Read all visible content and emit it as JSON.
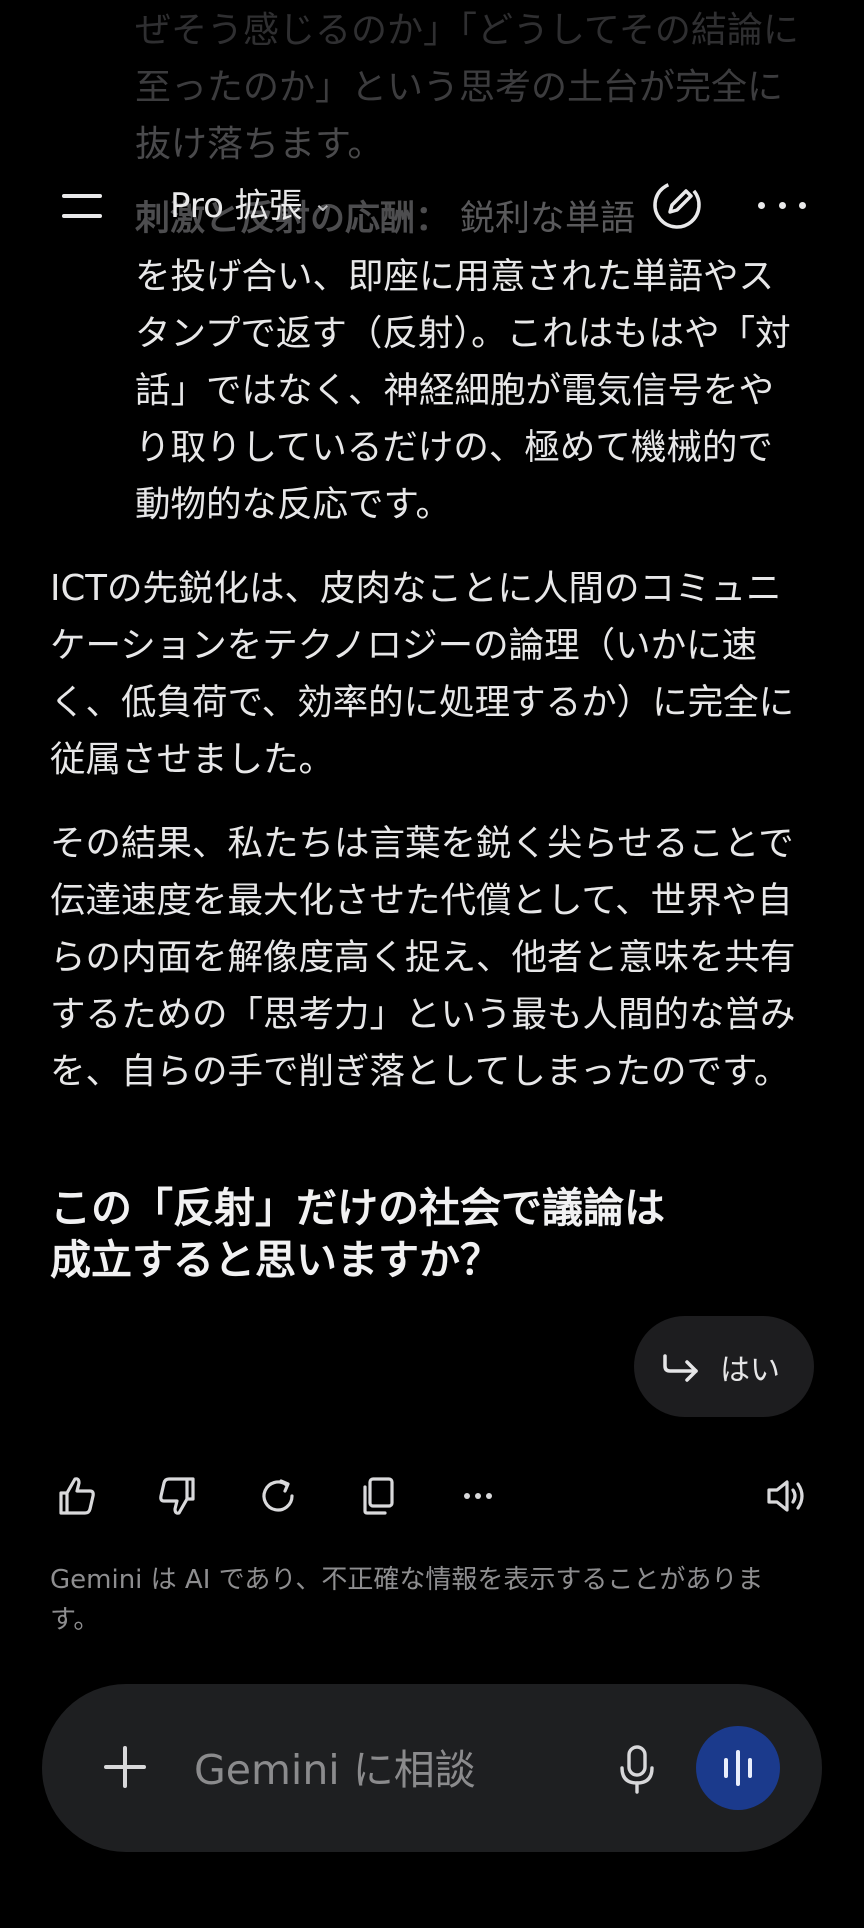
{
  "message": {
    "faded_lines": [
      "ぜそう感じるのか」「どうしてその結論に",
      "至ったのか」という思考の土台が完全に",
      "抜け落ちます。"
    ],
    "bullet_title": "刺激と反射の応酬：",
    "bullet_first_line_tail": "鋭利な単語",
    "bullet_lines": [
      "を投げ合い、即座に用意された単語やス",
      "タンプで返す（反射）。これはもはや「対",
      "話」ではなく、神経細胞が電気信号をや",
      "り取りしているだけの、極めて機械的で",
      "動物的な反応です。"
    ],
    "paragraph1": [
      "ICTの先鋭化は、皮肉なことに人間のコミュニ",
      "ケーションをテクノロジーの論理（いかに速",
      "く、低負荷で、効率的に処理するか）に完全に",
      "従属させました。"
    ],
    "paragraph2": [
      "その結果、私たちは言葉を鋭く尖らせることで",
      "伝達速度を最大化させた代償として、世界や自",
      "らの内面を解像度高く捉え、他者と意味を共有",
      "するための「思考力」という最も人間的な営み",
      "を、自らの手で削ぎ落としてしまったのです。"
    ],
    "question_lines": [
      "この「反射」だけの社会で議論は",
      "成立すると思いますか？"
    ]
  },
  "topbar": {
    "model_label": "Pro 拡張",
    "model_chevron": "⌄",
    "menu_icon": "hamburger-icon",
    "edit_icon": "new-chat-pencil-icon",
    "more_icon": "more-horizontal-icon"
  },
  "suggestion_chip": {
    "label": "はい",
    "icon": "reply-arrow-icon"
  },
  "actions": {
    "icons": [
      "thumbs-up-icon",
      "thumbs-down-icon",
      "regenerate-icon",
      "copy-icon",
      "more-icon",
      "speaker-icon"
    ]
  },
  "disclaimer": "Gemini は AI であり、不正確な情報を表示することがありま す。",
  "input": {
    "placeholder": "Gemini に相談",
    "plus_icon": "plus-icon",
    "mic_icon": "microphone-icon",
    "live_icon": "live-voice-icon",
    "live_button_color": "#1b3a8c"
  }
}
